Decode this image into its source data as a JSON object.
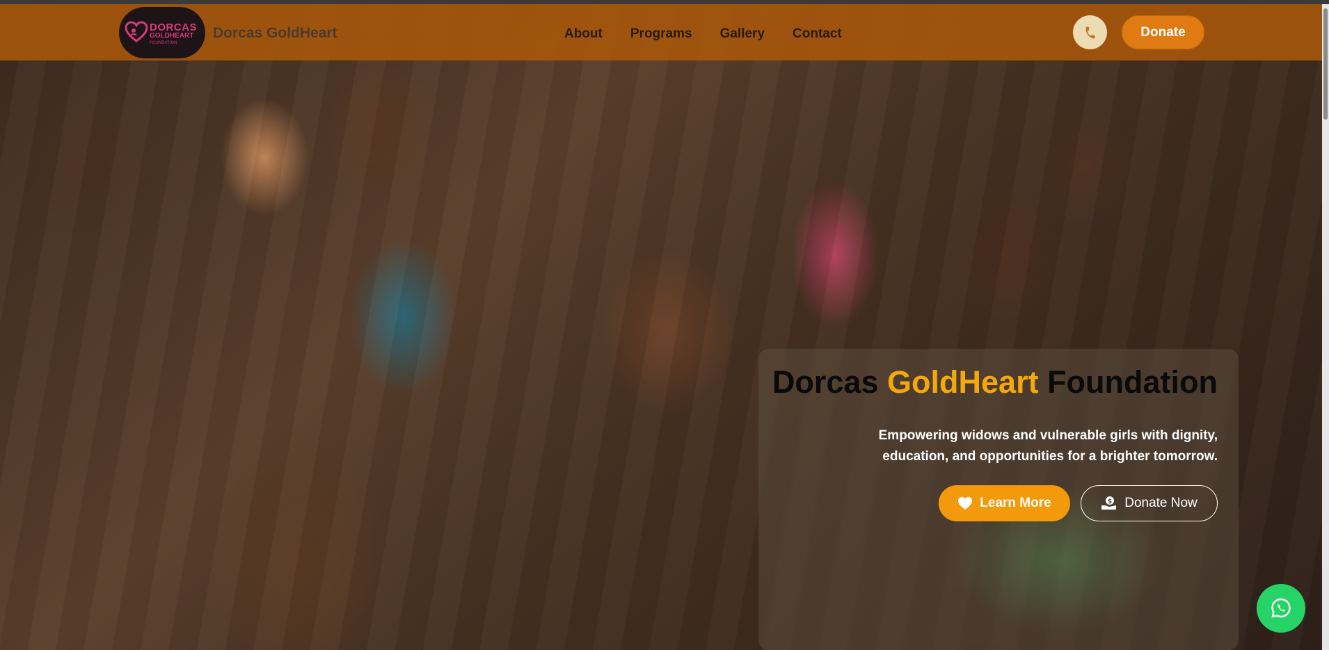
{
  "brand": {
    "logo_line1": "DORCAS",
    "logo_line2": "GOLDHEART",
    "logo_line3": "FOUNDATION",
    "name": "Dorcas GoldHeart"
  },
  "nav": {
    "links": [
      {
        "label": "About"
      },
      {
        "label": "Programs"
      },
      {
        "label": "Gallery"
      },
      {
        "label": "Contact"
      }
    ],
    "donate_label": "Donate",
    "phone_icon": "phone-icon"
  },
  "hero": {
    "title_part1": "Dorcas ",
    "title_highlight": "GoldHeart",
    "title_part2": " Foundation",
    "subtitle": "Empowering widows and vulnerable girls with dignity, education, and opportunities for a brighter tomorrow.",
    "learn_more_label": "Learn More",
    "donate_now_label": "Donate Now"
  },
  "colors": {
    "navbar": "#a8580a",
    "accent_gold": "#f5a80c",
    "donate_orange": "#e07a12",
    "whatsapp_green": "#25d366"
  },
  "icons": {
    "learn_more": "heart-icon",
    "donate_now": "money-hand-icon",
    "whatsapp": "whatsapp-icon"
  }
}
